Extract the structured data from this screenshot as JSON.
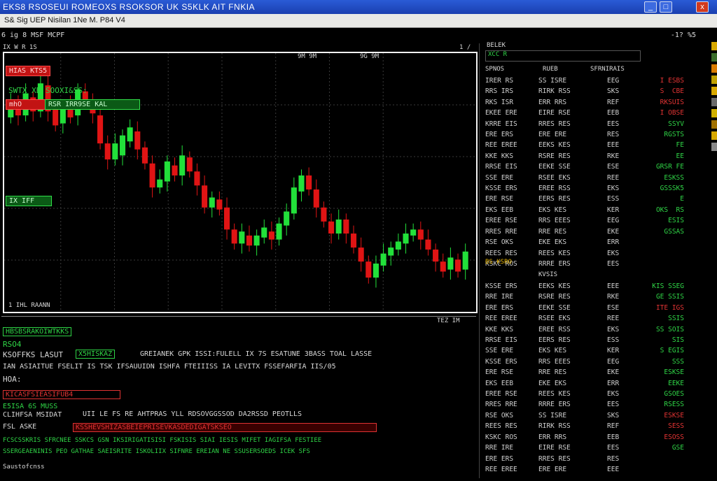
{
  "window": {
    "title": "EKS8 RSOSEUI ROMEOXS RSOKSOR UK S5KLK AIT FNKIA",
    "min": "_",
    "max": "□",
    "close": "x"
  },
  "menubar": {
    "text": "S& Sig UEP   Nisilan 1Ne   M. P84 V4"
  },
  "header": {
    "left": "6 ig 8  MSF MCPF",
    "right": "-1? %5"
  },
  "chart_toolbar": {
    "left": "IX  W  R 1S",
    "center_a": "9M  9M",
    "center_b": "9G  9M",
    "right": "1 /"
  },
  "chart": {
    "red_tag_1": "HIAS  KTS5",
    "green_label": "SWTX  XB  SOOXI&SS:",
    "red_tag_2": "mhO",
    "green_tag_1": "RSR  IRR9SE  KAL",
    "green_tag_2": "IX  IFF",
    "bottom_left": "1  IHL  RAANN",
    "bottom_right": "TEZ  IM"
  },
  "chart_data": {
    "type": "candlestick",
    "series": [
      {
        "values": [
          {
            "o": 205,
            "c": 214
          },
          {
            "o": 212,
            "c": 206
          },
          {
            "o": 206,
            "c": 217
          },
          {
            "o": 215,
            "c": 208
          },
          {
            "o": 208,
            "c": 222
          },
          {
            "o": 221,
            "c": 208
          },
          {
            "o": 209,
            "c": 201
          },
          {
            "o": 202,
            "c": 210
          },
          {
            "o": 211,
            "c": 205
          },
          {
            "o": 206,
            "c": 219
          },
          {
            "o": 218,
            "c": 212
          },
          {
            "o": 212,
            "c": 207
          },
          {
            "o": 206,
            "c": 192
          },
          {
            "o": 192,
            "c": 184
          },
          {
            "o": 184,
            "c": 192
          },
          {
            "o": 186,
            "c": 196
          },
          {
            "o": 193,
            "c": 200
          },
          {
            "o": 198,
            "c": 189
          },
          {
            "o": 190,
            "c": 182
          },
          {
            "o": 182,
            "c": 170
          },
          {
            "o": 170,
            "c": 174
          },
          {
            "o": 173,
            "c": 183
          },
          {
            "o": 181,
            "c": 176
          },
          {
            "o": 176,
            "c": 186
          },
          {
            "o": 185,
            "c": 178
          },
          {
            "o": 178,
            "c": 171
          },
          {
            "o": 171,
            "c": 160
          },
          {
            "o": 160,
            "c": 165
          },
          {
            "o": 164,
            "c": 159
          },
          {
            "o": 160,
            "c": 149
          },
          {
            "o": 149,
            "c": 142
          },
          {
            "o": 142,
            "c": 148
          },
          {
            "o": 146,
            "c": 141
          },
          {
            "o": 141,
            "c": 146
          },
          {
            "o": 145,
            "c": 150
          },
          {
            "o": 148,
            "c": 144
          },
          {
            "o": 144,
            "c": 152
          },
          {
            "o": 151,
            "c": 158
          },
          {
            "o": 157,
            "c": 170
          },
          {
            "o": 168,
            "c": 176
          },
          {
            "o": 176,
            "c": 169
          },
          {
            "o": 169,
            "c": 160
          },
          {
            "o": 160,
            "c": 153
          },
          {
            "o": 153,
            "c": 147
          },
          {
            "o": 147,
            "c": 154
          },
          {
            "o": 154,
            "c": 147
          },
          {
            "o": 147,
            "c": 140
          },
          {
            "o": 140,
            "c": 133
          },
          {
            "o": 133,
            "c": 125
          },
          {
            "o": 125,
            "c": 132
          },
          {
            "o": 131,
            "c": 137
          },
          {
            "o": 136,
            "c": 140
          },
          {
            "o": 139,
            "c": 143
          },
          {
            "o": 142,
            "c": 147
          },
          {
            "o": 146,
            "c": 149
          },
          {
            "o": 149,
            "c": 144
          },
          {
            "o": 144,
            "c": 139
          },
          {
            "o": 139,
            "c": 133
          },
          {
            "o": 133,
            "c": 128
          },
          {
            "o": 129,
            "c": 135
          },
          {
            "o": 134,
            "c": 128
          },
          {
            "o": 129,
            "c": 138
          }
        ]
      }
    ],
    "up_color": "#22e03a",
    "down_color": "#e01414",
    "ylim": [
      110,
      235
    ],
    "grid": true
  },
  "info_panel": {
    "line1": "HBSBSRAKOIWTKKS",
    "line2": "RSO4",
    "line3a": "KSOFFKS LASUT",
    "line3_box": "X5HISKAZ",
    "line3b": "GREIANEK  GPK  ISSI:FULELL  IX 7S  ESATUNE  3BASS  TOAL  LASSE",
    "line4": "IAN  ASIAITUE  FSELIT  IS  TSK  IFSAUUIDN  ISHFA  FTEIIISS  IA  LEVITX  FSSEFARFIA  IIS/05",
    "line5": "HOA:",
    "line6_red": "KICASFSIEASIFUB4",
    "line7a": "E5ISA  6S  MUSS",
    "line7b": "CLIHFSA  MSIDAT",
    "line7c": "UII  LE  FS  RE  AHTPRAS  YLL  RDSOVGGSSOD  DA2RSSD  PEOTLLS",
    "line8a": "FSL  ASKE",
    "line8_redbar": "KSSHEVSHIZASBEIEPRISEVKASDEDIGATSKSEO",
    "line9": "FCSCSSKRIS  SFRCNEE  SSKCS  GSN  IKSIRIGATISISI  FSKISIS  SIAI  IESIS  MIFET  IAGIFSA  FESTIEE",
    "line10": "SSERGEAENINIS  PEO  GATHAE  SAEISRITE  ISKOLIIX  SIFNRE  EREIAN  NE  SSUSERSOEDS  ICEK  SFS",
    "footer": "Saustofcnss"
  },
  "right_panel": {
    "top_a": "BELEK",
    "top_b": "XCC  R",
    "head_1": "SPNOS",
    "head_2": "RUEB",
    "head_3": "SFRNIRAIS",
    "col1": [
      "IRER RS",
      "RRS IRS",
      "RKS ISR",
      "EKEE ERE",
      "KRRE EIS",
      "ERE ERS",
      "REE EREE",
      "KKE KKS",
      "RRSE EIS",
      "SSE ERE",
      "KSSE ERS",
      "ERE RSE",
      "EKS EEB",
      "EREE RSE",
      "RRES RRE",
      "RSE OKS",
      "REES RES",
      "KSKC ROS"
    ],
    "col2": [
      "SS ISRE",
      "RIRK RSS",
      "ERR RRS",
      "EIRE RSE",
      "RRES RES",
      "ERE ERE",
      "EEKS KES",
      "RSRE RES",
      "EEKE SSE",
      "RSEE EKS",
      "EREE RSS",
      "EERS RES",
      "EKS KES",
      "RRS EEES",
      "RRE RES",
      "EKE EKS",
      "REES KES",
      "RRRE ERS"
    ],
    "col3": [
      "EEG",
      "SKS",
      "REF",
      "EEB",
      "EES",
      "RES",
      "EEE",
      "RKE",
      "ESE",
      "REE",
      "EKS",
      "ESS",
      "KER",
      "EEG",
      "EKE",
      "ERR",
      "EKS",
      "EES"
    ],
    "col4": [
      {
        "t": "I ESBS",
        "c": "r"
      },
      {
        "t": "S  CBE",
        "c": "r"
      },
      {
        "t": "RKSUIS",
        "c": "r"
      },
      {
        "t": "I OBSE",
        "c": "r"
      },
      {
        "t": "SSYV",
        "c": "g"
      },
      {
        "t": "RGSTS",
        "c": "g"
      },
      {
        "t": "FE",
        "c": "g"
      },
      {
        "t": "EE",
        "c": "g"
      },
      {
        "t": "GRSR FE",
        "c": "g"
      },
      {
        "t": "ESKSS",
        "c": "g"
      },
      {
        "t": "GSSSK5",
        "c": "g"
      },
      {
        "t": "E",
        "c": "g"
      },
      {
        "t": "OKS  RS",
        "c": "g"
      },
      {
        "t": "ESIS",
        "c": "g"
      },
      {
        "t": "GSSAS",
        "c": "g"
      }
    ],
    "mid_a": "BS KSRO",
    "mid_b": "KVSIS",
    "col1_b": [
      "KSSE ERS",
      "RRE IRE",
      "ERE ERS",
      "REE EREE",
      "KKE KKS",
      "RRSE EIS",
      "SSE ERE",
      "KSSE ERS",
      "ERE RSE",
      "EKS EEB",
      "EREE RSE",
      "RRES RRE",
      "RSE OKS",
      "REES RES",
      "KSKC ROS",
      "RRE IRE",
      "ERE ERS",
      "REE EREE"
    ],
    "col2_b": [
      "EEKS KES",
      "RSRE RES",
      "EEKE SSE",
      "RSEE EKS",
      "EREE RSS",
      "EERS RES",
      "EKS KES",
      "RRS EEES",
      "RRE RES",
      "EKE EKS",
      "REES KES",
      "RRRE ERS",
      "SS ISRE",
      "RIRK RSS",
      "ERR RRS",
      "EIRE RSE",
      "RRES RES",
      "ERE ERE"
    ],
    "col3_b": [
      "EEE",
      "RKE",
      "ESE",
      "REE",
      "EKS",
      "ESS",
      "KER",
      "EEG",
      "EKE",
      "ERR",
      "EKS",
      "EES",
      "SKS",
      "REF",
      "EEB",
      "EES",
      "RES",
      "EEE"
    ],
    "col4_b": [
      {
        "t": "KIS SSEG",
        "c": "g"
      },
      {
        "t": "GE SSIS",
        "c": "g"
      },
      {
        "t": "ITE IGS",
        "c": "r"
      },
      {
        "t": "SSIS",
        "c": "g"
      },
      {
        "t": "SS SOIS",
        "c": "g"
      },
      {
        "t": "SIS",
        "c": "g"
      },
      {
        "t": "S EGIS",
        "c": "g"
      },
      {
        "t": "SSS",
        "c": "g"
      },
      {
        "t": "ESKSE",
        "c": "g"
      },
      {
        "t": "EEKE",
        "c": "g"
      },
      {
        "t": "GSOES",
        "c": "g"
      },
      {
        "t": "RSESS",
        "c": "g"
      },
      {
        "t": "ESKSE",
        "c": "r"
      },
      {
        "t": "SESS",
        "c": "r"
      },
      {
        "t": "ESOSS",
        "c": "r"
      },
      {
        "t": "GSE",
        "c": "g"
      }
    ]
  }
}
